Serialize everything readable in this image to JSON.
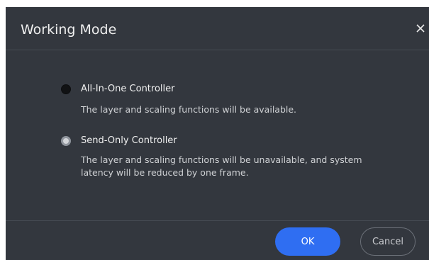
{
  "dialog": {
    "title": "Working Mode",
    "close_icon": "close-icon",
    "options": [
      {
        "label": "All-In-One Controller",
        "description": "The layer and scaling functions will be available.",
        "selected": false
      },
      {
        "label": "Send-Only Controller",
        "description": "The layer and scaling functions will be unavailable, and system latency will be reduced by one frame.",
        "selected": true
      }
    ],
    "buttons": {
      "ok": "OK",
      "cancel": "Cancel"
    }
  },
  "colors": {
    "background": "#33373e",
    "primary": "#2f6ef2",
    "divider": "#464b53"
  }
}
